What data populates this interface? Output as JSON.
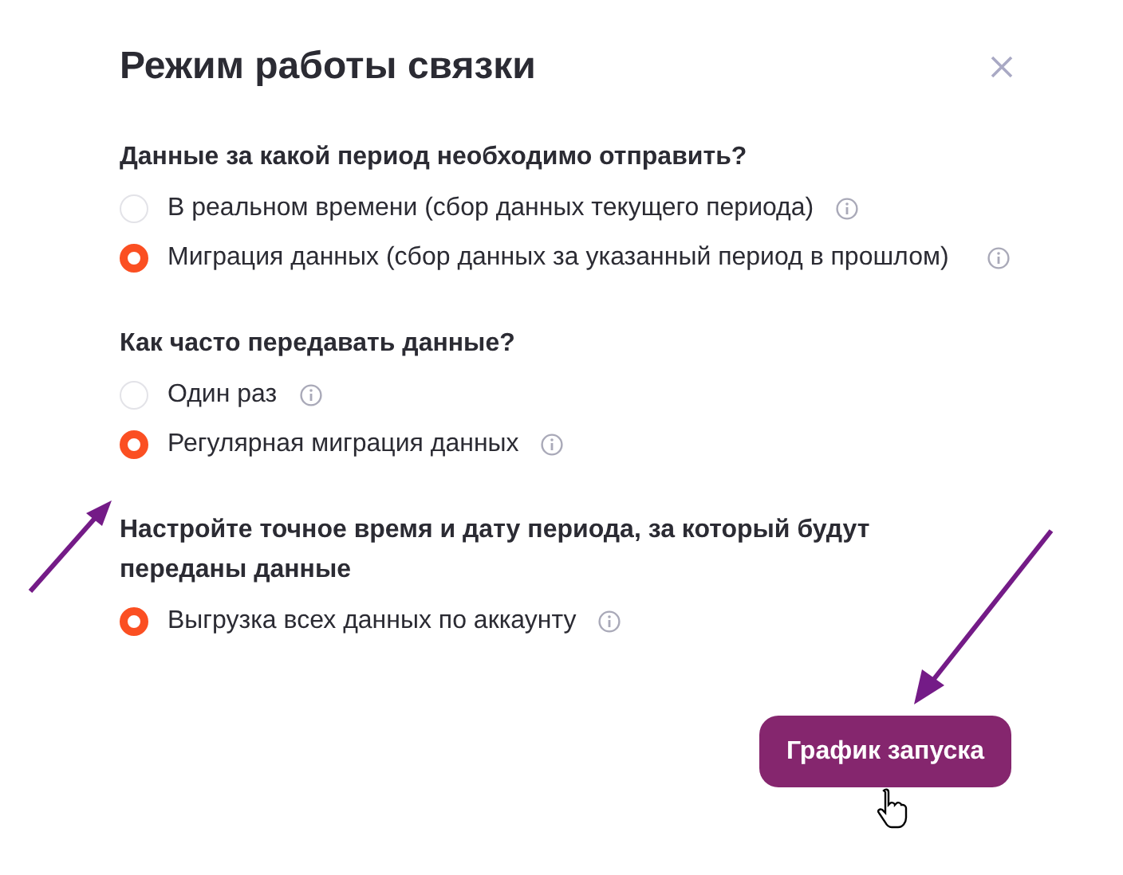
{
  "dialog": {
    "title": "Режим работы связки"
  },
  "sections": [
    {
      "heading": "Данные за какой период необходимо отправить?",
      "options": [
        {
          "label": "В реальном времени (сбор данных текущего периода)",
          "selected": false
        },
        {
          "label": "Миграция данных (сбор данных за указанный период в прошлом)",
          "selected": true
        }
      ]
    },
    {
      "heading": "Как часто передавать данные?",
      "options": [
        {
          "label": "Один раз",
          "selected": false
        },
        {
          "label": "Регулярная миграция данных",
          "selected": true
        }
      ]
    },
    {
      "heading": "Настройте точное время и дату периода, за который будут переданы данные",
      "options": [
        {
          "label": "Выгрузка всех данных по аккаунту",
          "selected": true
        }
      ]
    }
  ],
  "button": {
    "label": "График запуска"
  }
}
